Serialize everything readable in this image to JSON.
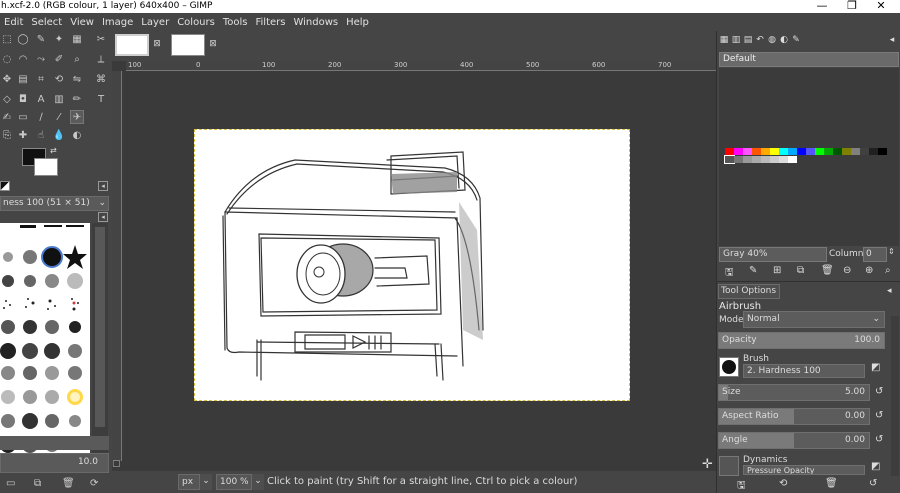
{
  "window": {
    "title": "h.xcf-2.0 (RGB colour, 1 layer) 640x400 – GIMP",
    "minimize": "—",
    "maximize": "❐",
    "close": "✕"
  },
  "menu": [
    "Edit",
    "Select",
    "View",
    "Image",
    "Layer",
    "Colours",
    "Tools",
    "Filters",
    "Windows",
    "Help"
  ],
  "toolbox": {
    "brush_title": "ness 100 (51 × 51)",
    "spacing_value": "10.0"
  },
  "ruler": {
    "top_labels": [
      "100",
      "0",
      "100",
      "200",
      "300",
      "400",
      "500",
      "600",
      "700"
    ]
  },
  "statusbar": {
    "unit": "px",
    "zoom": "100 %",
    "message": "Click to paint (try Shift for a straight line, Ctrl to pick a colour)"
  },
  "palette": {
    "selected": "Default",
    "color_name": "Gray 40%",
    "columns_label": "Columns:",
    "columns_value": "0",
    "swatches_row1": [
      "#ff0000",
      "#ff00ff",
      "#ff55ff",
      "#ff5500",
      "#ffaa00",
      "#ffff00",
      "#00ffff",
      "#00aaff",
      "#0000ff",
      "#5555ff",
      "#00ff00",
      "#00aa00",
      "#005500",
      "#808000",
      "#808080",
      "#404040",
      "#202020",
      "#000000"
    ],
    "swatches_row2": [
      "#555555",
      "#777777",
      "#999999",
      "#aaaaaa",
      "#bbbbbb",
      "#cccccc",
      "#dddddd",
      "#ffffff"
    ]
  },
  "tool_options": {
    "tab_label": "Tool Options",
    "tool_name": "Airbrush",
    "mode_label": "Mode:",
    "mode_value": "Normal",
    "opacity_label": "Opacity",
    "opacity_value": "100.0",
    "brush_label": "Brush",
    "brush_value": "2. Hardness 100",
    "size_label": "Size",
    "size_value": "5.00",
    "aspect_label": "Aspect Ratio",
    "aspect_value": "0.00",
    "angle_label": "Angle",
    "angle_value": "0.00",
    "dynamics_label": "Dynamics",
    "dynamics_value": "Pressure Opacity"
  }
}
